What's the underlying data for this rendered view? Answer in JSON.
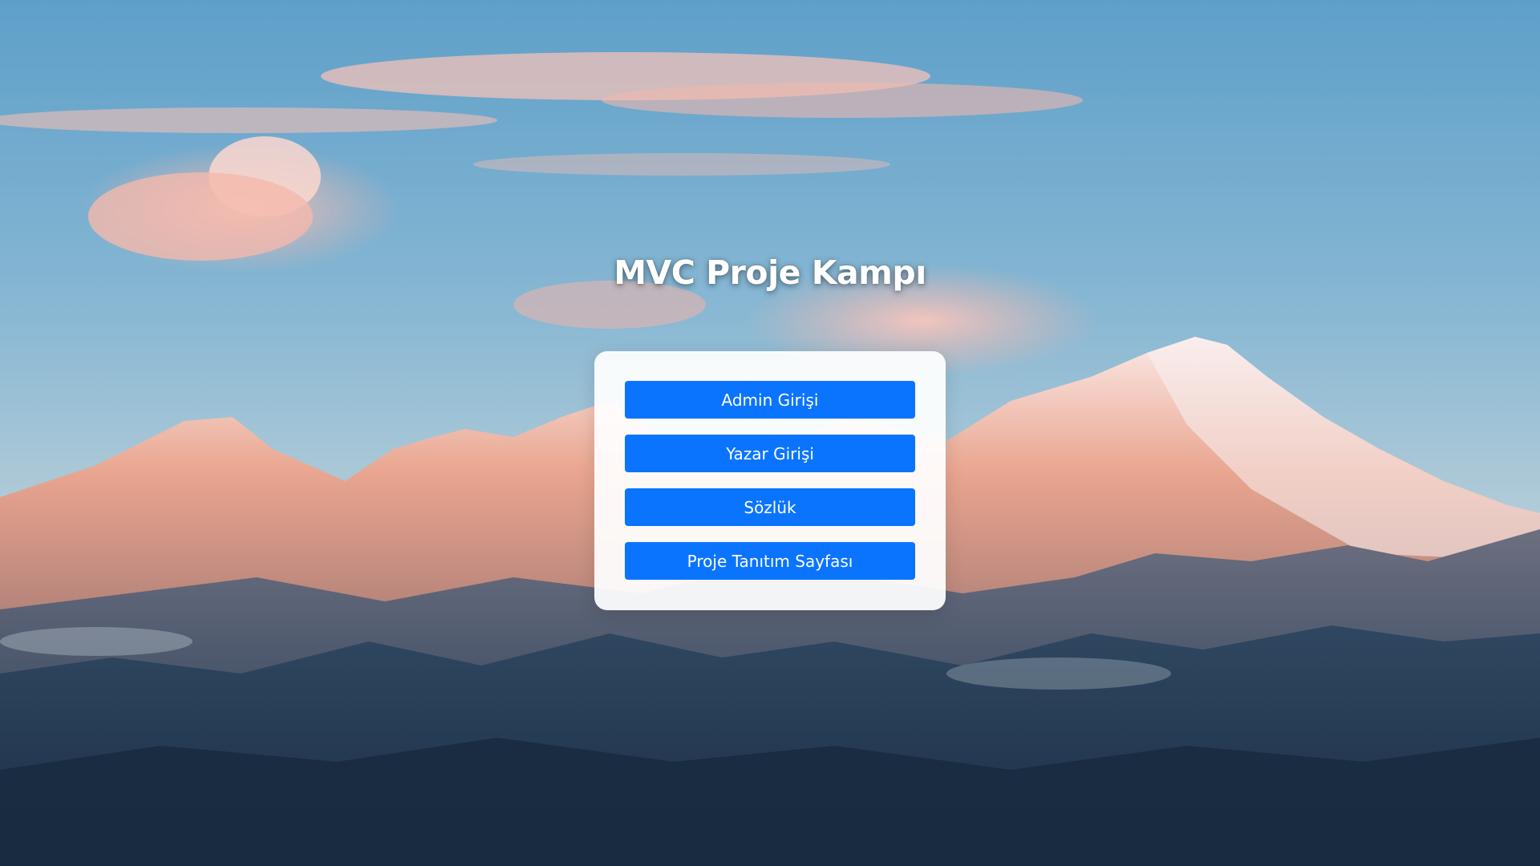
{
  "page": {
    "title": "MVC Proje Kampı"
  },
  "menu": {
    "buttons": [
      {
        "label": "Admin Girişi"
      },
      {
        "label": "Yazar Girişi"
      },
      {
        "label": "Sözlük"
      },
      {
        "label": "Proje Tanıtım Sayfası"
      }
    ]
  },
  "colors": {
    "button_bg": "#0a74ff",
    "button_text": "#ffffff",
    "title_text": "#ffffff",
    "card_bg": "#ffffff"
  }
}
